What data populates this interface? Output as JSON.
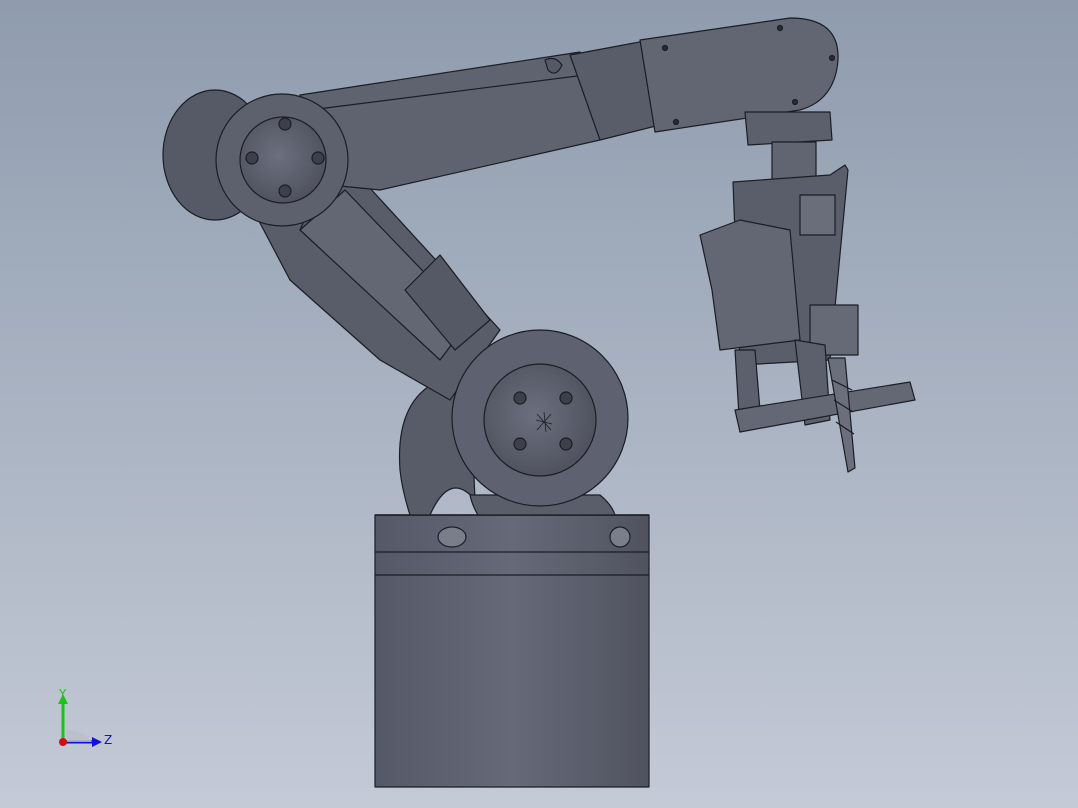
{
  "viewport": {
    "background_top": "#8f9cae",
    "background_bottom": "#c4cad6",
    "model_color": "#5d616e",
    "edge_color": "#1b1d24"
  },
  "triad": {
    "y_label": "Y",
    "z_label": "Z",
    "y_color": "#19c419",
    "z_color": "#1010e0",
    "x_color": "#d01010"
  }
}
